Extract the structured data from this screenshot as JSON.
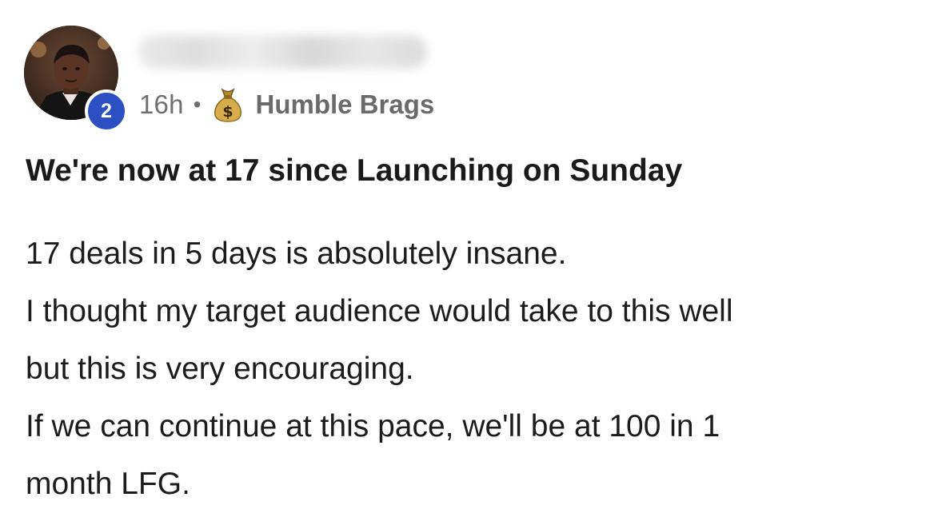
{
  "post": {
    "author": {
      "level_badge": "2",
      "avatar_icon": "person-avatar-photo",
      "name_blurred": true
    },
    "meta": {
      "time": "16h",
      "separator": "•",
      "group_icon": "money-bag-icon",
      "group_name": "Humble Brags"
    },
    "title": "We're now at 17 since Launching on Sunday",
    "body_lines": [
      "17 deals in 5 days is absolutely insane.",
      "I thought my target audience would take to this well",
      "but this is very encouraging.",
      "If we can continue at this pace, we'll be at 100 in 1",
      "month LFG."
    ]
  },
  "colors": {
    "badge": "#2c4fc4",
    "meta_text": "#6f6f6f",
    "title_text": "#1a1a1a",
    "body_text": "#1c1c1c",
    "money_bag": "#c9a13b"
  }
}
